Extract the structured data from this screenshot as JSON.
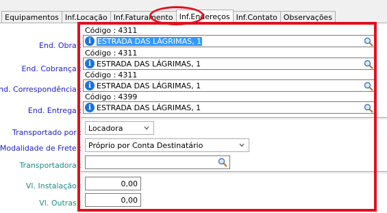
{
  "tabs": [
    {
      "label": "Equipamentos"
    },
    {
      "label": "Inf.Locação"
    },
    {
      "label": "Inf.Faturamento"
    },
    {
      "label": "Inf.Endereços"
    },
    {
      "label": "Inf.Contato"
    },
    {
      "label": "Observações"
    }
  ],
  "active_tab": "Inf.Endereços",
  "addresses": [
    {
      "label": "End. Obra :",
      "codigo_label": "Código :",
      "codigo": "4311",
      "value": "ESTRADA DAS LÁGRIMAS, 1",
      "selected": true
    },
    {
      "label": "End. Cobrança :",
      "codigo_label": "Código :",
      "codigo": "4311",
      "value": "ESTRADA DAS LÁGRIMAS, 1",
      "selected": false
    },
    {
      "label": "End. Correspondência :",
      "codigo_label": "Código :",
      "codigo": "4311",
      "value": "ESTRADA DAS LÁGRIMAS, 1",
      "selected": false
    },
    {
      "label": "End. Entrega :",
      "codigo_label": "Código :",
      "codigo": "4399",
      "value": "ESTRADA DAS LÁGRIMAS, 1",
      "selected": false
    }
  ],
  "transport": {
    "transportado_por_label": "Transportado por :",
    "transportado_por_value": "Locadora",
    "modalidade_label": "Modalidade de Frete :",
    "modalidade_value": "Próprio por Conta Destinatário",
    "transportadora_label": "Transportadora :",
    "transportadora_value": ""
  },
  "values": {
    "instalacao_label": "Vl. Instalação :",
    "instalacao_value": "0,00",
    "outras_label": "Vl. Outras :",
    "outras_value": "0,00"
  },
  "colors": {
    "highlight": "#e0101e",
    "label_blue": "#1d1dc4",
    "label_teal": "#1a8a86",
    "selection": "#3399ff"
  }
}
